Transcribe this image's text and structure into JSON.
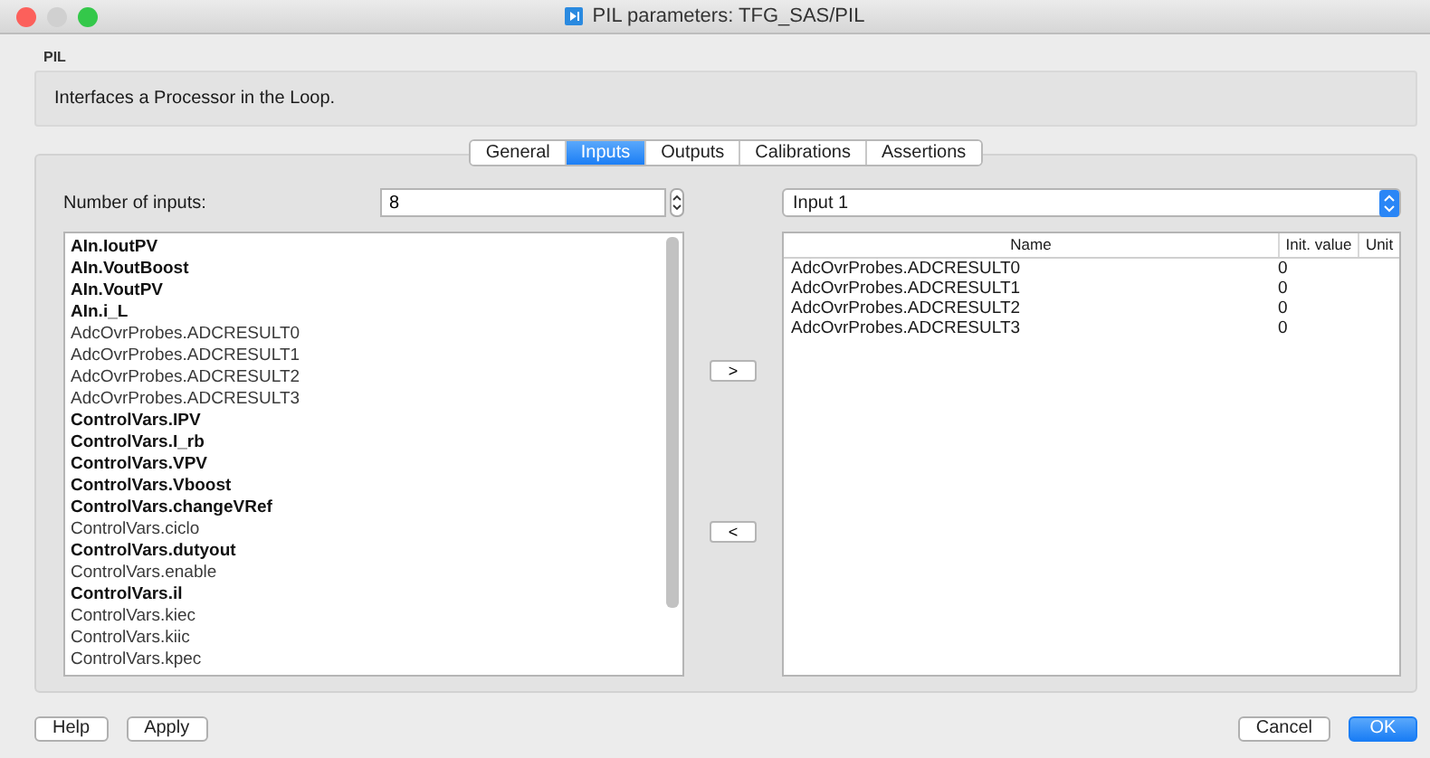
{
  "window": {
    "title": "PIL parameters: TFG_SAS/PIL"
  },
  "section_label": "PIL",
  "description": "Interfaces a Processor in the Loop.",
  "tabs": [
    {
      "label": "General",
      "selected": false
    },
    {
      "label": "Inputs",
      "selected": true
    },
    {
      "label": "Outputs",
      "selected": false
    },
    {
      "label": "Calibrations",
      "selected": false
    },
    {
      "label": "Assertions",
      "selected": false
    }
  ],
  "number_of_inputs": {
    "label": "Number of inputs:",
    "value": "8"
  },
  "signals": [
    {
      "name": "AIn.IoutPV",
      "emphasized": true
    },
    {
      "name": "AIn.VoutBoost",
      "emphasized": true
    },
    {
      "name": "AIn.VoutPV",
      "emphasized": true
    },
    {
      "name": "AIn.i_L",
      "emphasized": true
    },
    {
      "name": "AdcOvrProbes.ADCRESULT0",
      "emphasized": false
    },
    {
      "name": "AdcOvrProbes.ADCRESULT1",
      "emphasized": false
    },
    {
      "name": "AdcOvrProbes.ADCRESULT2",
      "emphasized": false
    },
    {
      "name": "AdcOvrProbes.ADCRESULT3",
      "emphasized": false
    },
    {
      "name": "ControlVars.IPV",
      "emphasized": true
    },
    {
      "name": "ControlVars.I_rb",
      "emphasized": true
    },
    {
      "name": "ControlVars.VPV",
      "emphasized": true
    },
    {
      "name": "ControlVars.Vboost",
      "emphasized": true
    },
    {
      "name": "ControlVars.changeVRef",
      "emphasized": true
    },
    {
      "name": "ControlVars.ciclo",
      "emphasized": false
    },
    {
      "name": "ControlVars.dutyout",
      "emphasized": true
    },
    {
      "name": "ControlVars.enable",
      "emphasized": false
    },
    {
      "name": "ControlVars.il",
      "emphasized": true
    },
    {
      "name": "ControlVars.kiec",
      "emphasized": false
    },
    {
      "name": "ControlVars.kiic",
      "emphasized": false
    },
    {
      "name": "ControlVars.kpec",
      "emphasized": false
    }
  ],
  "add_button": ">",
  "remove_button": "<",
  "input_select": {
    "value": "Input 1"
  },
  "table": {
    "columns": [
      "Name",
      "Init. value",
      "Unit"
    ],
    "rows": [
      [
        "AdcOvrProbes.ADCRESULT0",
        "0"
      ],
      [
        "AdcOvrProbes.ADCRESULT1",
        "0"
      ],
      [
        "AdcOvrProbes.ADCRESULT2",
        "0"
      ],
      [
        "AdcOvrProbes.ADCRESULT3",
        "0"
      ]
    ]
  },
  "buttons_left": [
    "Help",
    "Apply"
  ],
  "buttons_right": [
    {
      "label": "Cancel",
      "kind": "normal"
    },
    {
      "label": "OK",
      "kind": "default"
    }
  ]
}
